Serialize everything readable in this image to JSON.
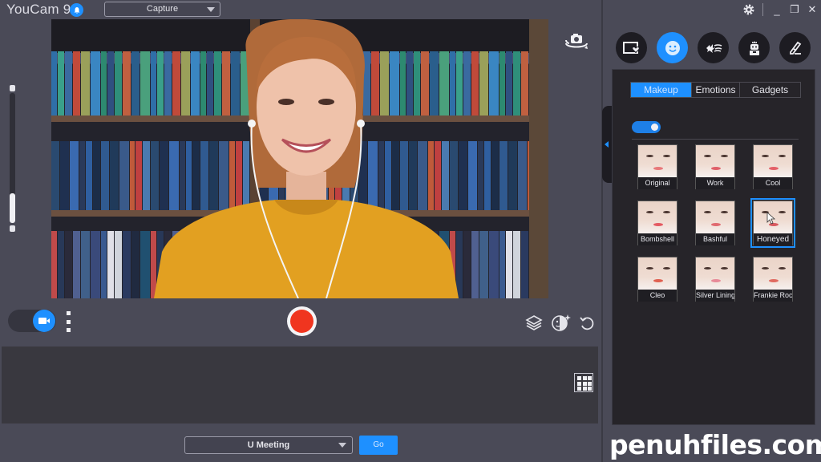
{
  "app": {
    "title": "YouCam 9",
    "mode_select": "Capture",
    "notification_icon": "bell-icon"
  },
  "window_controls": {
    "settings": "gear-icon",
    "minimize": "_",
    "restore": "❐",
    "close": "✕"
  },
  "preview": {
    "zoom_level": 0.22,
    "switch_camera_icon": "camera-rotate-icon"
  },
  "controls": {
    "camera_toggle_icon": "video-camera-icon",
    "more_icon": "more-vertical-icon",
    "record_icon": "record-icon",
    "layers_icon": "layers-icon",
    "face_enhance_icon": "face-sparkle-icon",
    "undo_icon": "undo-icon",
    "grid_icon": "grid-icon"
  },
  "meeting": {
    "selected": "U Meeting",
    "go_label": "Go"
  },
  "right_panel": {
    "categories": [
      {
        "name": "frames",
        "icon": "frame-heart-icon",
        "active": false
      },
      {
        "name": "face",
        "icon": "smiley-icon",
        "active": true
      },
      {
        "name": "particles",
        "icon": "splash-icon",
        "active": false
      },
      {
        "name": "avatar",
        "icon": "avatar-icon",
        "active": false
      },
      {
        "name": "draw",
        "icon": "pen-icon",
        "active": false
      }
    ],
    "tabs": [
      {
        "label": "Makeup",
        "active": true
      },
      {
        "label": "Emotions",
        "active": false
      },
      {
        "label": "Gadgets",
        "active": false
      }
    ],
    "makeup_enabled": true,
    "looks": [
      {
        "label": "Original",
        "selected": false
      },
      {
        "label": "Work",
        "selected": false
      },
      {
        "label": "Cool",
        "selected": false
      },
      {
        "label": "Bombshell",
        "selected": false
      },
      {
        "label": "Bashful",
        "selected": false
      },
      {
        "label": "Honeyed",
        "selected": true
      },
      {
        "label": "Cleo",
        "selected": false
      },
      {
        "label": "Silver Lining",
        "selected": false
      },
      {
        "label": "Frankie Roc",
        "selected": false
      }
    ]
  },
  "colors": {
    "accent": "#1e90ff",
    "record": "#f0351f",
    "background": "#4a4a57",
    "panel_dark": "#262429"
  },
  "watermark": "penuhfiles.com"
}
